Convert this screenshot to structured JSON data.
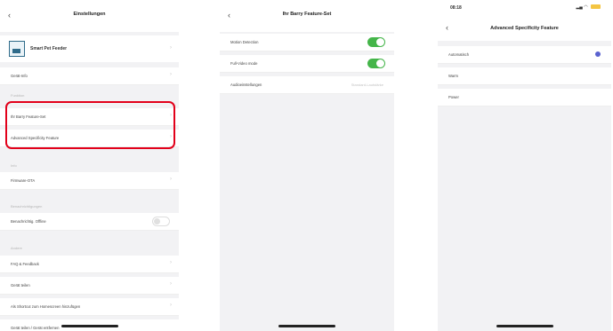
{
  "screen1": {
    "nav": {
      "back_icon": "chevron-left-icon",
      "title": "Einstellungen"
    },
    "device": {
      "name": "Smart Pet Feeder",
      "icon": "pet-feeder-icon"
    },
    "rows": {
      "device_info": "Gerät-Info",
      "feature_set": "Ihr Barry Feature-Set",
      "adv_features": "Advanced Specificity Feature",
      "firmware": "Firmware-OTA",
      "offline_notify": "Benachrichtig. Offline",
      "faq_feedback": "FAQ & Feedback",
      "share_device": "Gerät teilen",
      "add_to_home": "Als Shortcut zum Homescreen hinzufügen",
      "last_row": "Gerät teilen / Gerät entfernen"
    },
    "sections": {
      "s1": "Funktion",
      "s2": "Info",
      "s3": "Benachrichtigungen",
      "s4": "Andere"
    },
    "highlight_color": "#e2001a"
  },
  "screen2": {
    "nav": {
      "back_icon": "chevron-left-icon",
      "title": "Ihr Barry Feature-Set"
    },
    "rows": {
      "motion": "Motion Detection",
      "night_vision": "Full-Video mode",
      "audio": "Audioeinstellungen",
      "audio_value": "Standard-Lautstärke"
    },
    "toggle_on_color": "#44b549"
  },
  "screen3": {
    "status": {
      "time": "08:18",
      "signal_icon": "signal-icon",
      "wifi_icon": "wifi-icon",
      "battery_icon": "battery-icon"
    },
    "nav": {
      "back_icon": "chevron-left-icon",
      "title": "Advanced Specificity Feature"
    },
    "rows": {
      "auto": "Automatisch",
      "warm": "Warm",
      "power": "Power"
    },
    "radio_color": "#5a62cf"
  }
}
